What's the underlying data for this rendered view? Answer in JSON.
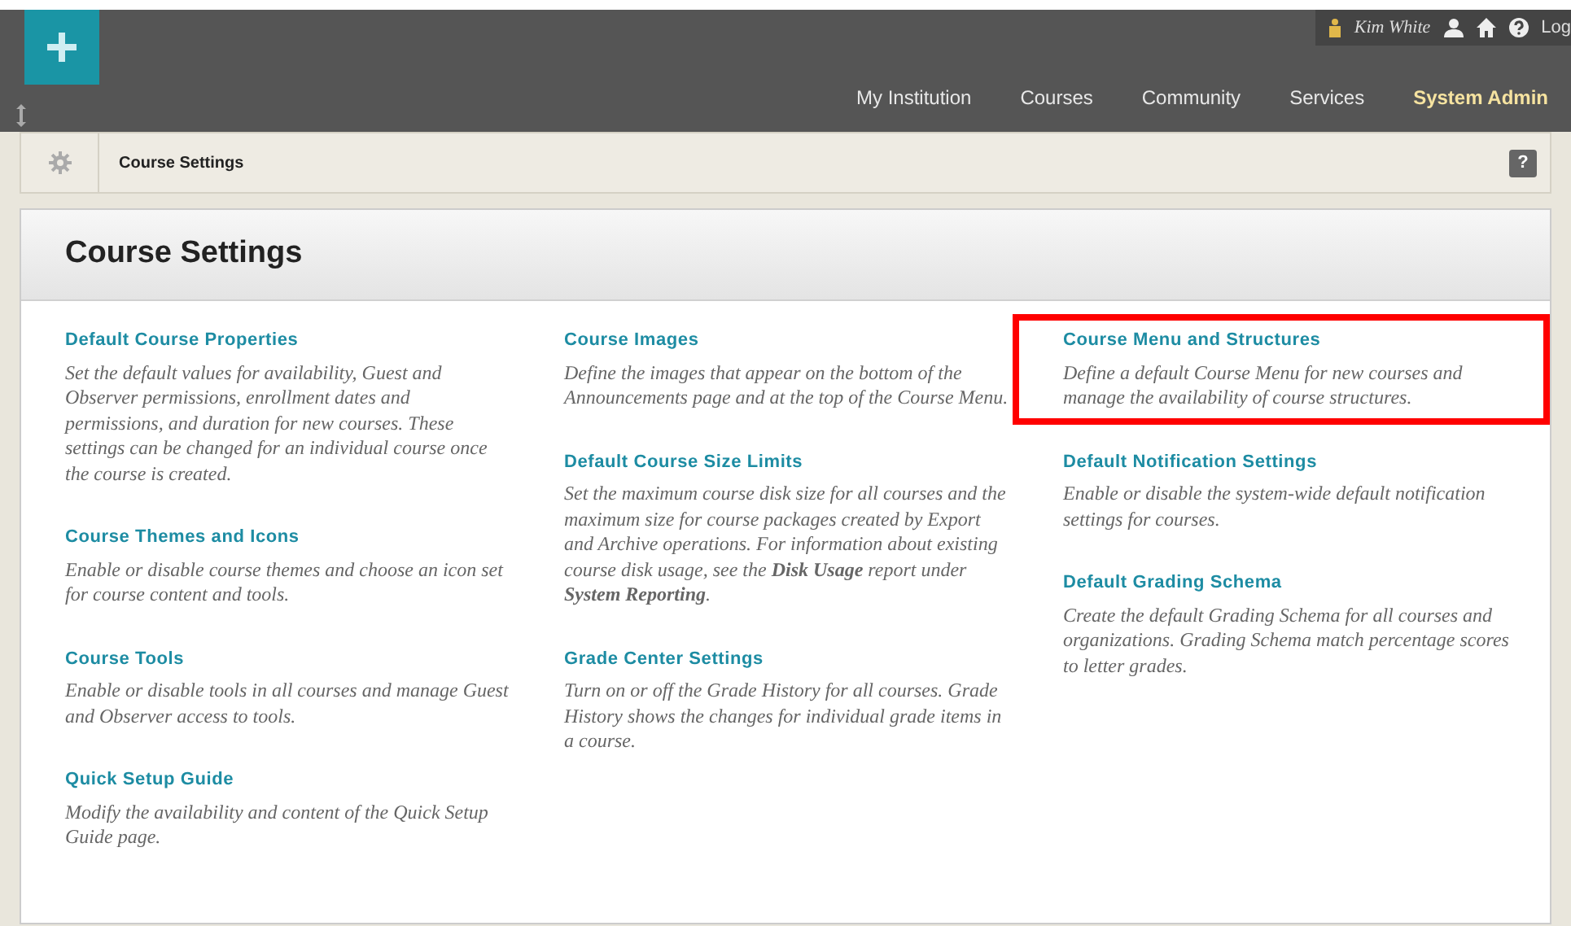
{
  "user_bar": {
    "user_name": "Kim White",
    "logout": "Log"
  },
  "nav": [
    {
      "label": "My Institution",
      "selected": false
    },
    {
      "label": "Courses",
      "selected": false
    },
    {
      "label": "Community",
      "selected": false
    },
    {
      "label": "Services",
      "selected": false
    },
    {
      "label": "System Admin",
      "selected": true
    }
  ],
  "breadcrumb": {
    "label": "Course Settings",
    "help": "?"
  },
  "page_title": "Course Settings",
  "columns": [
    [
      {
        "title": "Default Course Properties",
        "description": "Set the default values for availability, Guest and Observer permissions, enrollment dates and permissions, and duration for new courses. These settings can be changed for an individual course once the course is created.",
        "highlighted": false
      },
      {
        "title": "Course Themes and Icons",
        "description": "Enable or disable course themes and choose an icon set for course content and tools.",
        "highlighted": false
      },
      {
        "title": "Course Tools",
        "description": "Enable or disable tools in all courses and manage Guest and Observer access to tools.",
        "highlighted": false
      },
      {
        "title": "Quick Setup Guide",
        "description": "Modify the availability and content of the Quick Setup Guide page.",
        "highlighted": false
      }
    ],
    [
      {
        "title": "Course Images",
        "description": "Define the images that appear on the bottom of the Announcements page and at the top of the Course Menu.",
        "highlighted": false
      },
      {
        "title": "Default Course Size Limits",
        "description": "Set the maximum course disk size for all courses and the maximum size for course packages created by Export and Archive operations. For information about existing course disk usage, see the **Disk Usage** report under **System Reporting**.",
        "highlighted": false
      },
      {
        "title": "Grade Center Settings",
        "description": "Turn on or off the Grade History for all courses. Grade History shows the changes for individual grade items in a course.",
        "highlighted": false
      }
    ],
    [
      {
        "title": "Course Menu and Structures",
        "description": "Define a default Course Menu for new courses and manage the availability of course structures.",
        "highlighted": true
      },
      {
        "title": "Default Notification Settings",
        "description": "Enable or disable the system-wide default notification settings for courses.",
        "highlighted": false
      },
      {
        "title": "Default Grading Schema",
        "description": "Create the default Grading Schema for all courses and organizations. Grading Schema match percentage scores to letter grades.",
        "highlighted": false
      }
    ]
  ]
}
